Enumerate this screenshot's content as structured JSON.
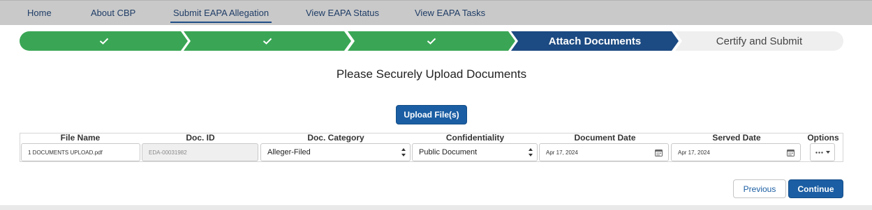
{
  "nav": {
    "items": [
      {
        "label": "Home"
      },
      {
        "label": "About CBP"
      },
      {
        "label": "Submit EAPA Allegation"
      },
      {
        "label": "View EAPA Status"
      },
      {
        "label": "View EAPA Tasks"
      }
    ],
    "active_index": 2
  },
  "progress": {
    "steps": [
      {
        "label": "",
        "state": "complete",
        "icon": "check-icon"
      },
      {
        "label": "",
        "state": "complete",
        "icon": "check-icon"
      },
      {
        "label": "",
        "state": "complete",
        "icon": "check-icon"
      },
      {
        "label": "Attach Documents",
        "state": "current"
      },
      {
        "label": "Certify and Submit",
        "state": "upcoming"
      }
    ],
    "colors": {
      "complete": "#3aa655",
      "current": "#1c4a82",
      "upcoming": "#efefef"
    }
  },
  "page": {
    "heading": "Please Securely Upload Documents",
    "upload_button": "Upload File(s)"
  },
  "table": {
    "headers": [
      "File Name",
      "Doc. ID",
      "Doc. Category",
      "Confidentiality",
      "Document Date",
      "Served Date",
      "Options"
    ],
    "rows": [
      {
        "file_name": "1 DOCUMENTS UPLOAD.pdf",
        "doc_id": "EDA-00031982",
        "doc_category": "Alleger-Filed",
        "confidentiality": "Public Document",
        "document_date": "Apr 17, 2024",
        "served_date": "Apr 17, 2024",
        "options_icon": "more-options-icon"
      }
    ]
  },
  "footer": {
    "previous_button": "Previous",
    "continue_button": "Continue"
  }
}
